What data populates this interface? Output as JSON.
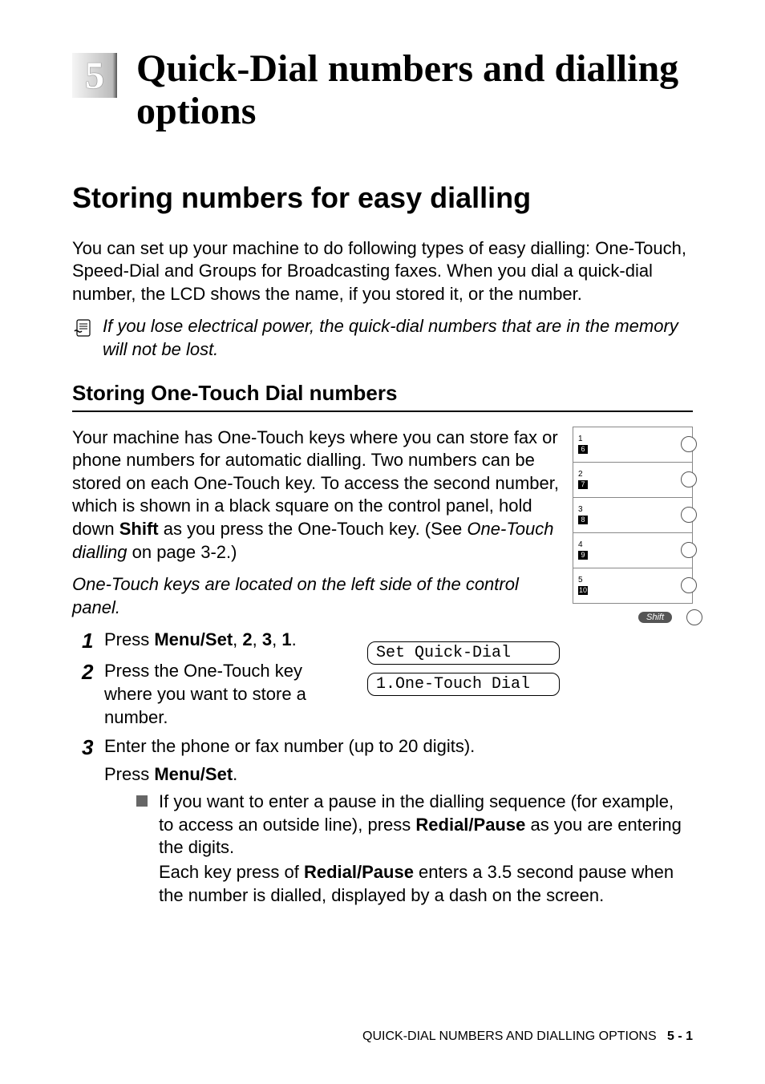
{
  "chapter": {
    "number": "5",
    "title": "Quick-Dial numbers and dialling options"
  },
  "section": {
    "heading": "Storing numbers for easy dialling",
    "intro": "You can set up your machine to do following types of easy dialling: One-Touch, Speed-Dial and Groups for Broadcasting faxes. When you dial a quick-dial number, the LCD shows the name, if you stored it, or the number.",
    "note": "If you lose electrical power, the quick-dial numbers that are in the memory will not be lost."
  },
  "subsection": {
    "heading": "Storing One-Touch Dial numbers",
    "para1_a": "Your machine has One-Touch keys where you can store fax or phone numbers for automatic dialling. Two numbers can be stored on each One-Touch key. To access the second number, which is shown in a black square on the control panel, hold down ",
    "para1_bold": "Shift",
    "para1_b": " as you press the One-Touch key. (See ",
    "para1_link": "One-Touch dialling",
    "para1_c": " on page 3-2.)",
    "para2": "One-Touch keys are located on the left side of the control panel."
  },
  "keypad": {
    "rows": [
      {
        "top": "1",
        "bot": "6"
      },
      {
        "top": "2",
        "bot": "7"
      },
      {
        "top": "3",
        "bot": "8"
      },
      {
        "top": "4",
        "bot": "9"
      },
      {
        "top": "5",
        "bot": "10"
      }
    ],
    "shift": "Shift"
  },
  "lcd": {
    "line1": "Set Quick-Dial",
    "line2": "1.One-Touch Dial"
  },
  "steps": {
    "s1_a": "Press ",
    "s1_bold": "Menu/Set",
    "s1_b": ", ",
    "s1_k1": "2",
    "s1_c": ", ",
    "s1_k2": "3",
    "s1_d": ", ",
    "s1_k3": "1",
    "s1_e": ".",
    "s2": "Press the One-Touch key where you want to store a number.",
    "s3_a": "Enter the phone or fax number (up to 20 digits).",
    "s3_b_a": "Press ",
    "s3_b_bold": "Menu/Set",
    "s3_b_b": ".",
    "bullet_a": "If you want to enter a pause in the dialling sequence (for example, to access an outside line), press ",
    "bullet_bold1": "Redial/Pause",
    "bullet_b": " as you are entering the digits.",
    "bullet_c_a": "Each key press of ",
    "bullet_bold2": "Redial/Pause",
    "bullet_c_b": " enters a 3.5 second pause when the number is dialled, displayed by a dash on the screen."
  },
  "footer": {
    "label": "QUICK-DIAL NUMBERS AND DIALLING OPTIONS",
    "page": "5 - 1"
  }
}
